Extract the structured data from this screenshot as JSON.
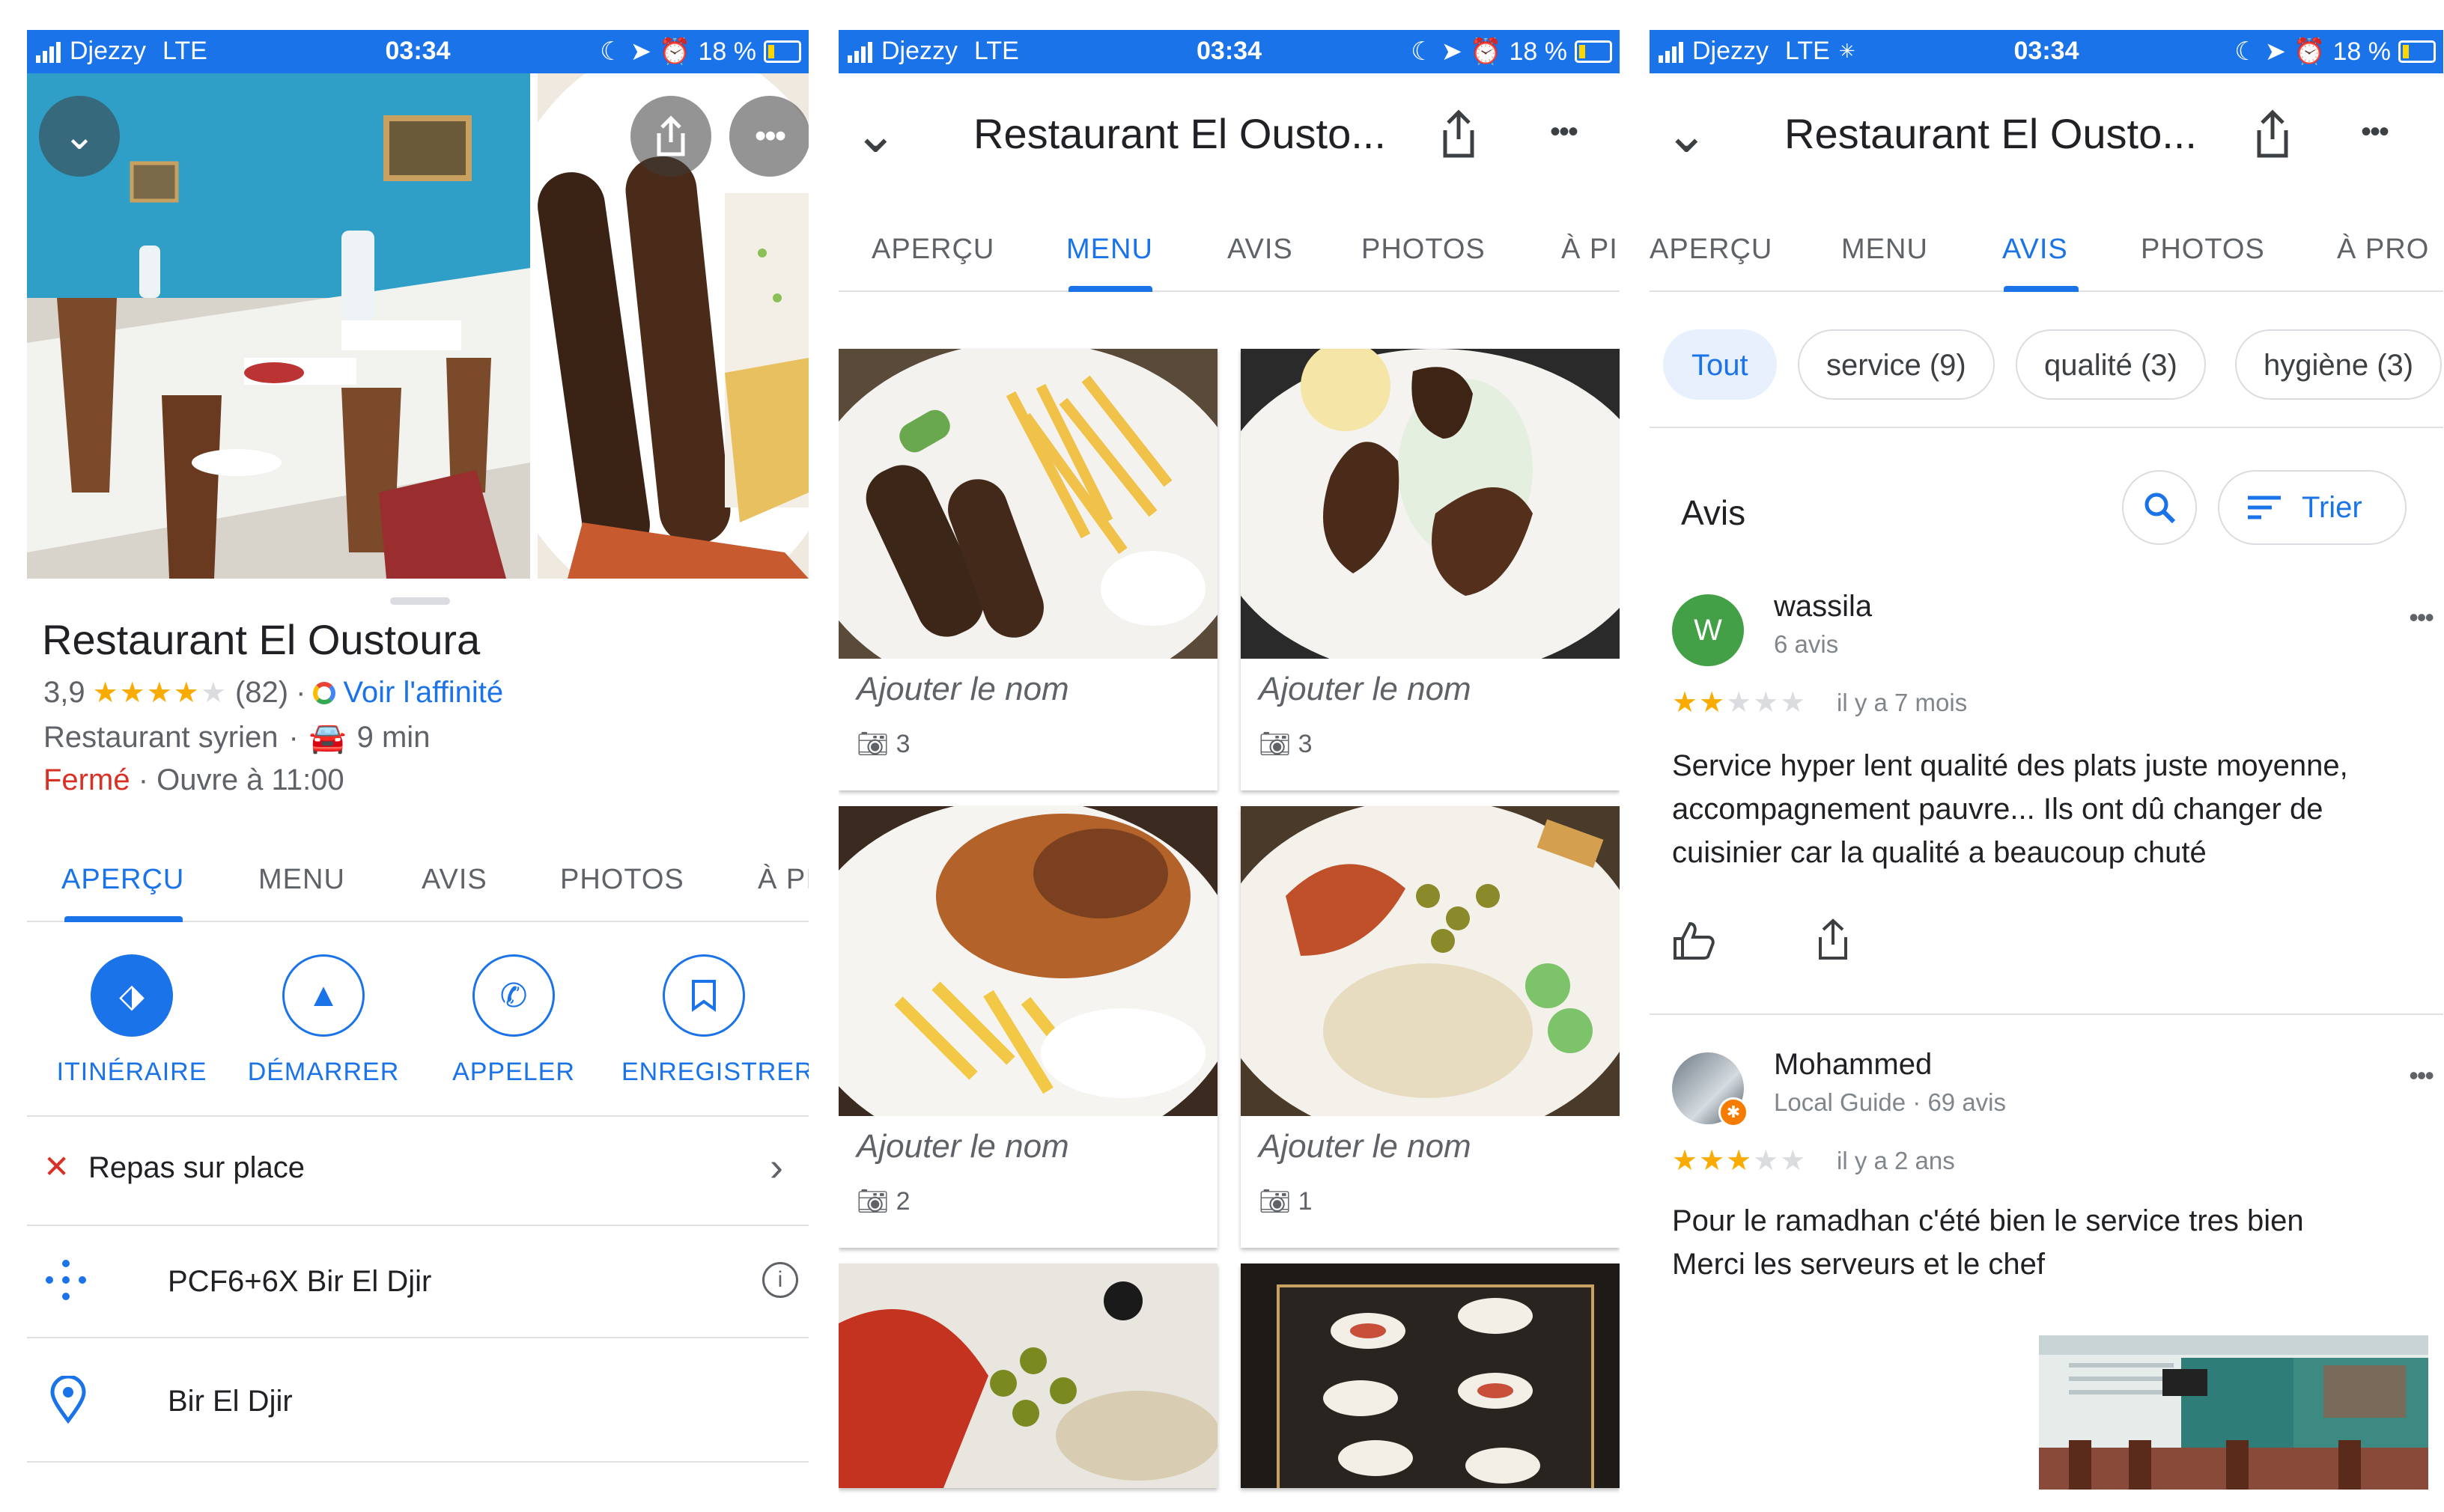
{
  "status_bar": {
    "carrier": "Djezzy",
    "network": "LTE",
    "time": "03:34",
    "battery": "18 %"
  },
  "colors": {
    "accent": "#1a73e8",
    "star": "#f9ab00",
    "closed": "#d93025"
  },
  "overview": {
    "title": "Restaurant El Oustoura",
    "rating": "3,9",
    "rating_stars": 3.9,
    "reviews_count": "(82)",
    "affinity_link": "Voir l'affinité",
    "category": "Restaurant syrien",
    "drive_time": "9 min",
    "status": "Fermé",
    "opens": "Ouvre à 11:00",
    "tabs": [
      "APERÇU",
      "MENU",
      "AVIS",
      "PHOTOS",
      "À PI"
    ],
    "actions": [
      "ITINÉRAIRE",
      "DÉMARRER",
      "APPELER",
      "ENREGISTRER"
    ],
    "dine_in": "Repas sur place",
    "plus_code": "PCF6+6X Bir El Djir",
    "locality": "Bir El Djir",
    "icons": [
      "chevron-down-icon",
      "share-icon",
      "more-icon",
      "directions-icon",
      "navigation-icon",
      "phone-icon",
      "bookmark-icon",
      "close-icon",
      "chevron-right-icon",
      "plus-code-icon",
      "info-icon",
      "location-pin-icon",
      "car-icon"
    ]
  },
  "menu": {
    "header_title": "Restaurant El Ousto...",
    "tabs": [
      "APERÇU",
      "MENU",
      "AVIS",
      "PHOTOS",
      "À PI"
    ],
    "items": [
      {
        "name": "Ajouter le nom",
        "photos": "3"
      },
      {
        "name": "Ajouter le nom",
        "photos": "3"
      },
      {
        "name": "Ajouter le nom",
        "photos": "2"
      },
      {
        "name": "Ajouter le nom",
        "photos": "1"
      }
    ]
  },
  "reviews": {
    "header_title": "Restaurant El Ousto...",
    "tabs": [
      "APERÇU",
      "MENU",
      "AVIS",
      "PHOTOS",
      "À PRO"
    ],
    "chips": [
      "Tout",
      "service (9)",
      "qualité (3)",
      "hygiène (3)"
    ],
    "section_title": "Avis",
    "sort_label": "Trier",
    "items": [
      {
        "avatar_letter": "W",
        "author": "wassila",
        "meta": "6 avis",
        "stars": 2,
        "date": "il y a 7 mois",
        "text_lines": [
          "Service hyper lent qualité des plats juste moyenne,",
          "accompagnement pauvre...  Ils ont dû changer de",
          "cuisinier car la qualité a beaucoup chuté"
        ]
      },
      {
        "avatar_letter": "",
        "author": "Mohammed",
        "meta": "Local Guide · 69 avis",
        "stars": 3,
        "date": "il y a 2 ans",
        "text_lines": [
          "Pour le ramadhan c'été bien le service tres bien",
          "Merci les serveurs et le chef"
        ]
      }
    ]
  }
}
